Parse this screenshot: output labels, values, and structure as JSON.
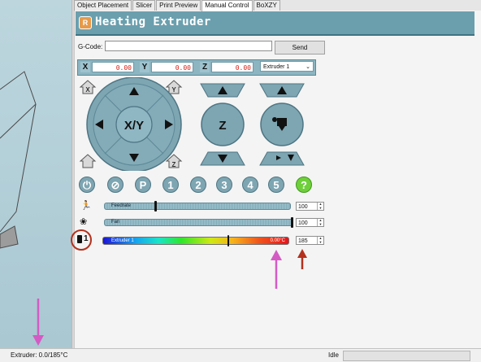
{
  "tabs": [
    {
      "label": "Object Placement"
    },
    {
      "label": "Slicer"
    },
    {
      "label": "Print Preview"
    },
    {
      "label": "Manual Control",
      "active": true
    },
    {
      "label": "BoXZY"
    }
  ],
  "header": {
    "title": "Heating Extruder",
    "logo_text": "R"
  },
  "gcode": {
    "label": "G-Code:",
    "value": "",
    "send_label": "Send"
  },
  "coordinates": {
    "x_label": "X",
    "x_value": "0.00",
    "y_label": "Y",
    "y_value": "0.00",
    "z_label": "Z",
    "z_value": "0.00"
  },
  "extruder_select": {
    "selected": "Extruder 1"
  },
  "jog": {
    "xy_label": "X/Y",
    "z_label": "Z",
    "home_x": "X",
    "home_y": "Y",
    "home_z": "Z"
  },
  "function_buttons": [
    {
      "label": "",
      "icon": "power-icon"
    },
    {
      "label": "",
      "icon": "disable-motors-icon"
    },
    {
      "label": "P",
      "icon": "park-icon"
    },
    {
      "label": "1"
    },
    {
      "label": "2"
    },
    {
      "label": "3"
    },
    {
      "label": "4"
    },
    {
      "label": "5"
    },
    {
      "label": "?",
      "icon": "help-icon"
    }
  ],
  "feedrate": {
    "label": "Feedrate",
    "value": "100",
    "level_percent": 27
  },
  "fan": {
    "label": "Fan",
    "value": "100",
    "level_percent": 100
  },
  "extruder_temp": {
    "label": "Extruder 1",
    "icon_label": "1",
    "current": "0.00°C",
    "target": "185",
    "target_level_percent": 67
  },
  "status": {
    "extruder": "Extruder: 0.0/185°C",
    "state": "Idle"
  },
  "colors": {
    "header": "#6b9fae",
    "coord_value": "#d8221a",
    "annotation_pink": "#d45bc4",
    "annotation_red": "#b3311d"
  }
}
